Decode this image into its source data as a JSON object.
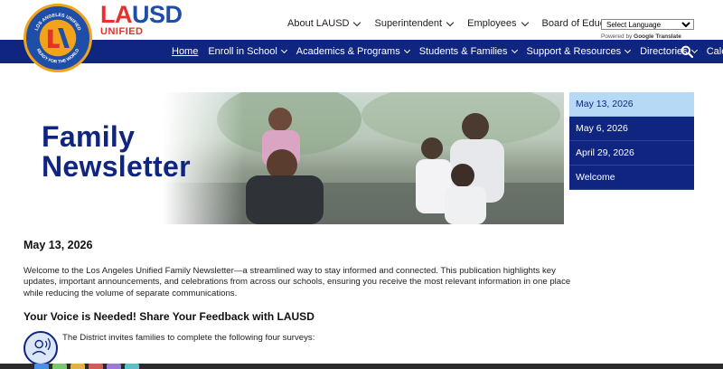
{
  "brand": {
    "seal_top_text": "LOS ANGELES UNIFIED",
    "seal_bottom_text": "READY FOR THE WORLD",
    "wordmark_la": "LA",
    "wordmark_usd": "USD",
    "wordmark_unified": "UNIFIED"
  },
  "top_nav": [
    {
      "label": "About LAUSD"
    },
    {
      "label": "Superintendent"
    },
    {
      "label": "Employees"
    },
    {
      "label": "Board of Education"
    }
  ],
  "language": {
    "selected": "Select Language",
    "powered_by_prefix": "Powered by",
    "powered_by_brand": "Google",
    "powered_by_suffix": "Translate"
  },
  "main_nav": [
    {
      "label": "Home",
      "active": true
    },
    {
      "label": "Enroll in School"
    },
    {
      "label": "Academics & Programs"
    },
    {
      "label": "Students & Families"
    },
    {
      "label": "Support & Resources"
    },
    {
      "label": "Directories"
    },
    {
      "label": "Calendars"
    }
  ],
  "hero": {
    "title_line1": "Family",
    "title_line2": "Newsletter"
  },
  "issues": [
    {
      "label": "May 13, 2026",
      "active": true
    },
    {
      "label": "May 6, 2026"
    },
    {
      "label": "April 29, 2026"
    },
    {
      "label": "Welcome"
    }
  ],
  "article": {
    "date": "May 13, 2026",
    "intro": "Welcome to the Los Angeles Unified Family Newsletter—a streamlined way to stay informed and connected. This publication highlights key updates, important announcements, and celebrations from across our schools, ensuring you receive the most relevant information in one place while reducing the volume of separate communications.",
    "feedback_heading": "Your Voice is Needed! Share Your Feedback with LAUSD",
    "survey_text": "The District invites families to complete the following four surveys:"
  },
  "colors": {
    "navy": "#102580",
    "brand_blue": "#1f4ea8",
    "brand_red": "#e4312b",
    "brand_gold": "#f2a31b",
    "issue_active": "#b6d9f6"
  }
}
